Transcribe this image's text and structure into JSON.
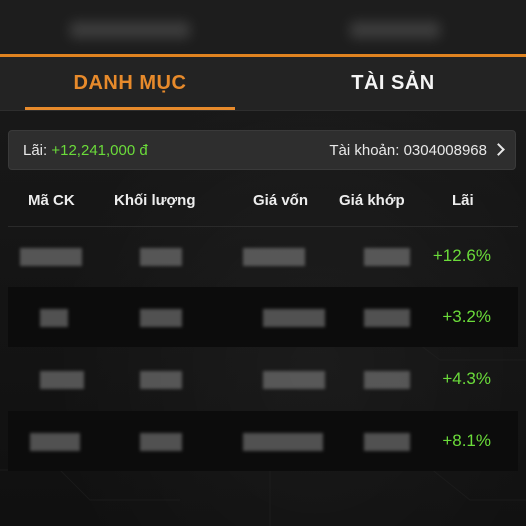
{
  "tabs": [
    {
      "label": "DANH MỤC",
      "active": true
    },
    {
      "label": "TÀI SẢN",
      "active": false
    }
  ],
  "summary": {
    "profit_label": "Lãi: ",
    "profit_value": "+12,241,000 đ",
    "account_text": "Tài khoản: 0304008968"
  },
  "columns": [
    "Mã CK",
    "Khối lượng",
    "Giá vốn",
    "Giá khớp",
    "Lãi"
  ],
  "rows": [
    {
      "profit": "+12.6%"
    },
    {
      "profit": "+3.2%"
    },
    {
      "profit": "+4.3%"
    },
    {
      "profit": "+8.1%"
    }
  ],
  "colors": {
    "accent": "#e78a2b",
    "positive": "#6bdc3a"
  }
}
